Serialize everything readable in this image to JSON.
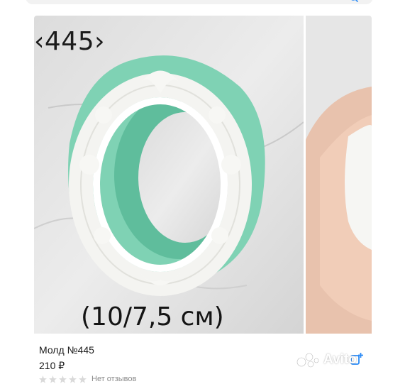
{
  "listing": {
    "photo_label": "‹445›",
    "photo_size": "(10/7,5 см)",
    "title": "Молд №445",
    "price": "210 ₽",
    "reviews": "Нет отзывов",
    "rating_stars": 0,
    "watermark": "Avito"
  },
  "colors": {
    "mold_mint": "#7fd2b4",
    "frame_white": "#f4f4f1",
    "stars_empty": "#d9d9d9",
    "compare_blue": "#2a8af6"
  },
  "icons": {
    "search": "search-icon",
    "compare": "compare-add-icon",
    "stars": "star-icon"
  }
}
